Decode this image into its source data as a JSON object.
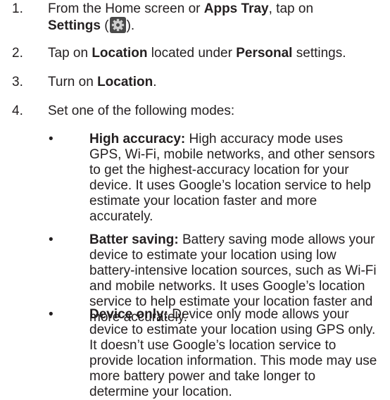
{
  "steps": [
    {
      "num": "1.",
      "line1_pre": "From the Home screen or ",
      "apps_tray": "Apps Tray",
      "line1_post": ", tap on",
      "settings": "Settings",
      "paren_open": " (",
      "icon": "settings-gear-icon",
      "paren_close": ")."
    },
    {
      "num": "2.",
      "pre": "Tap on ",
      "location": "Location",
      "mid": " located under ",
      "personal": "Personal",
      "post": " settings."
    },
    {
      "num": "3.",
      "pre": "Turn on ",
      "location": "Location",
      "post": "."
    },
    {
      "num": "4.",
      "text": "Set one of the following modes:"
    }
  ],
  "modes": [
    {
      "bullet": "•",
      "title": "High accuracy:",
      "description": " High accuracy mode uses GPS, Wi-Fi, mobile networks, and other sensors to get the highest-accuracy location for your device. It uses Google’s location service to help estimate your location faster and more accurately."
    },
    {
      "bullet": "•",
      "title": "Batter saving:",
      "description": " Battery saving mode allows your device to estimate your location using low battery-intensive location sources, such as Wi-Fi and mobile networks. It uses Google’s location service to help estimate your location faster and more accurately."
    },
    {
      "bullet": "•",
      "title": "Device only:",
      "description": " Device only mode allows your device to estimate your location using GPS only. It doesn’t use Google’s location service to provide location information. This mode may use more battery power and take longer to determine your location."
    }
  ],
  "colors": {
    "text": "#231f20",
    "icon_bg": "#4a4a4a",
    "icon_gear": "#cfcfcf"
  }
}
